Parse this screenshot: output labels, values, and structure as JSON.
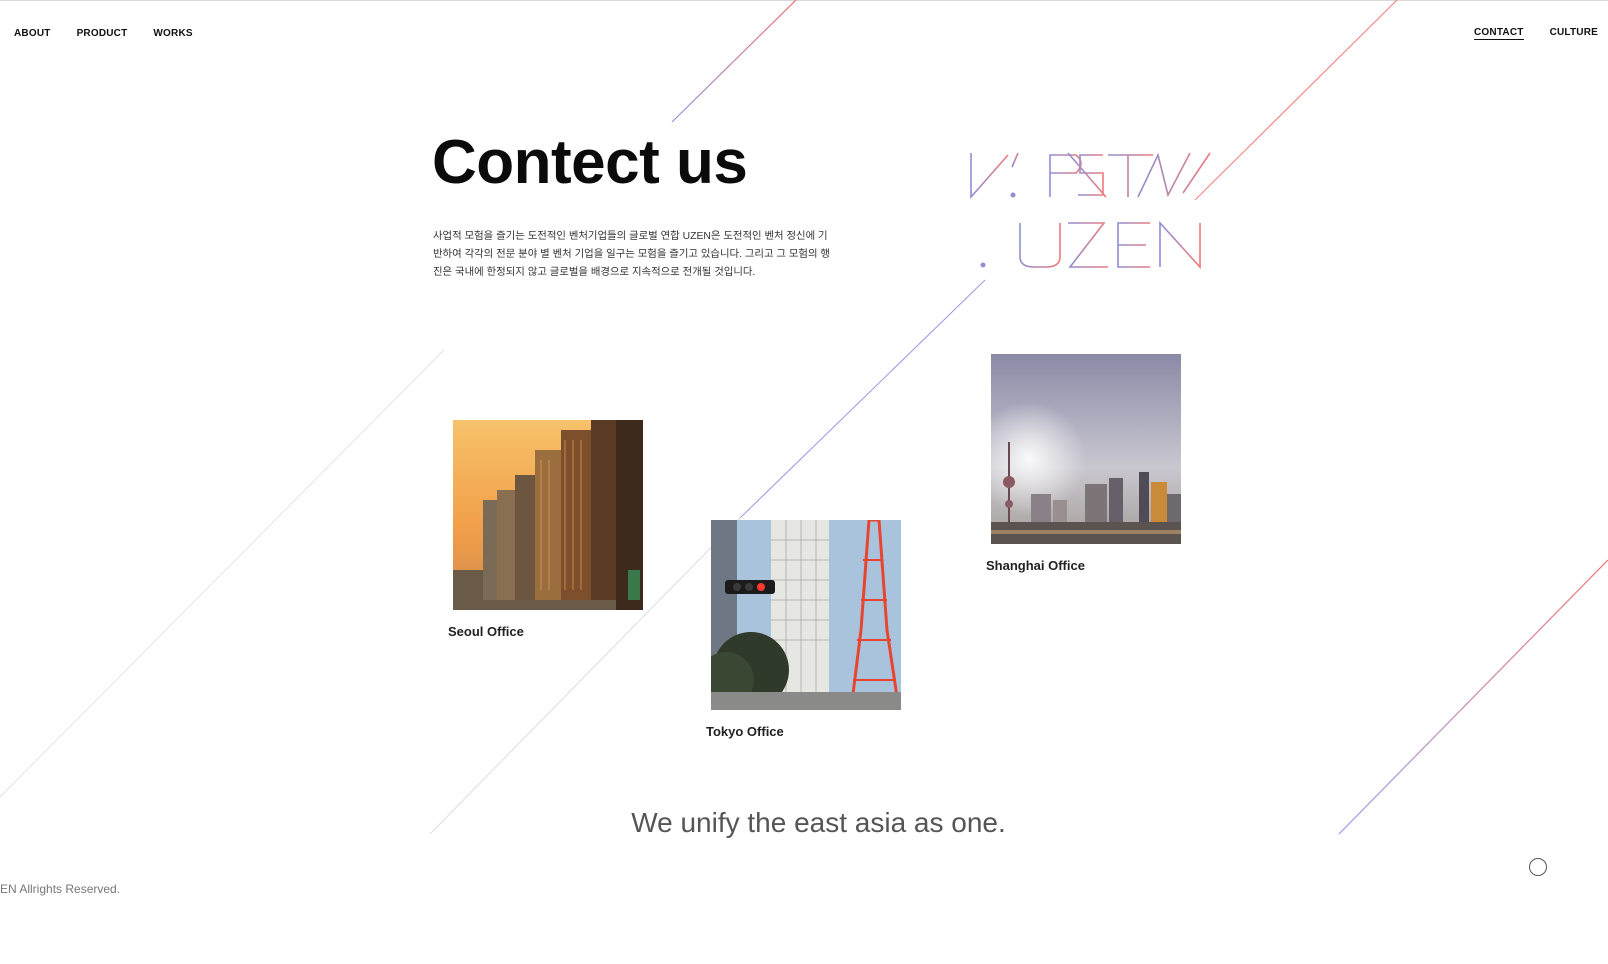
{
  "nav": {
    "left": [
      {
        "label": "ABOUT"
      },
      {
        "label": "PRODUCT"
      },
      {
        "label": "WORKS"
      }
    ],
    "right": [
      {
        "label": "CONTACT",
        "active": true
      },
      {
        "label": "CULTURE"
      }
    ]
  },
  "hero": {
    "title": "Contect us",
    "description": "사업적 모험을 즐기는 도전적인 벤처기업들의 글로벌 연합 UZEN은 도전적인 벤처 정신에 기반하여 각각의 전문 분야 별 벤처 기업을 일구는 모험을 즐기고 있습니다. 그리고 그 모험의 행진은 국내에 한정되지 않고 글로벌을 배경으로 지속적으로 전개될 것입니다."
  },
  "logo": {
    "top_text": "V'.PSTW",
    "bottom_text": ".UZEN",
    "gradient_start": "#8f8fd6",
    "gradient_end": "#f07a7a"
  },
  "offices": [
    {
      "name": "Seoul Office",
      "photo": "seoul-cityscape-sunset"
    },
    {
      "name": "Tokyo Office",
      "photo": "tokyo-tower-street"
    },
    {
      "name": "Shanghai Office",
      "photo": "shanghai-skyline"
    }
  ],
  "tagline": "We unify the east asia as one.",
  "footer": {
    "copyright": "EN Allrights Reserved."
  },
  "colors": {
    "accent_purple": "#7d7de0",
    "accent_red": "#f06b6b",
    "line_gray": "#d6d6e0"
  }
}
